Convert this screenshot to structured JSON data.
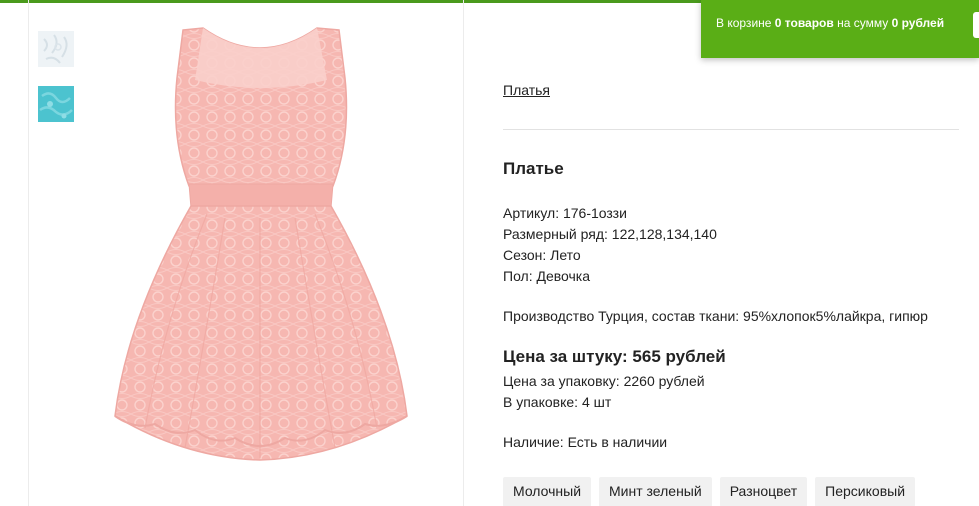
{
  "cart": {
    "prefix": "В корзине ",
    "items": "0 товаров",
    "middle": " на сумму ",
    "sum": "0 рублей"
  },
  "breadcrumb": "Платья",
  "product": {
    "title": "Платье",
    "properties": [
      "Артикул: 176-1оззи",
      "Размерный ряд: 122,128,134,140",
      "Сезон: Лето",
      "Пол: Девочка"
    ],
    "production": "Производство Турция, состав ткани: 95%хлопок5%лайкра, гипюр",
    "price_per_unit": "Цена за штуку: 565 рублей",
    "price_per_pack": "Цена за упаковку: 2260 рублей",
    "pack_size": "В упаковке: 4 шт",
    "availability": "Наличие: Есть в наличии",
    "colors": [
      "Молочный",
      "Минт зеленый",
      "Разноцвет",
      "Персиковый"
    ]
  },
  "theme": {
    "accent": "#5aae16",
    "dress_pink": "#f6b5b0"
  }
}
